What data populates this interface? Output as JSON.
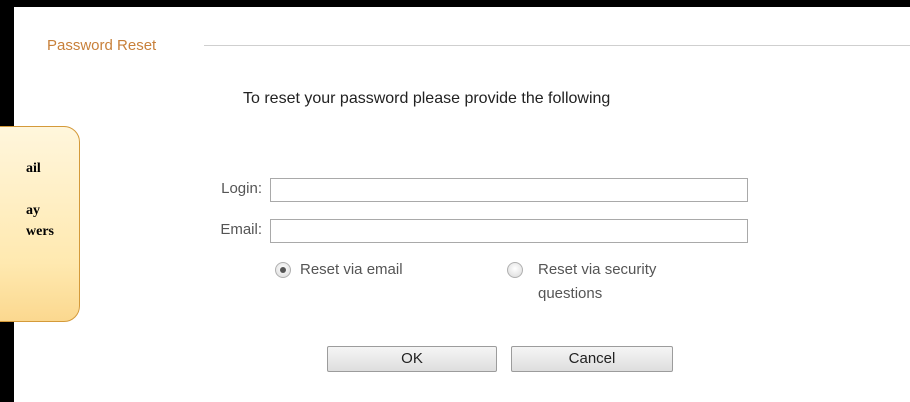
{
  "dialog": {
    "legend": "Password Reset",
    "instructions": "To reset your password please provide the following"
  },
  "form": {
    "login_label": "Login:",
    "login_value": "",
    "email_label": "Email:",
    "email_value": "",
    "reset_options": [
      {
        "label": "Reset via email",
        "selected": true
      },
      {
        "label": "Reset via security questions",
        "selected": false
      }
    ]
  },
  "buttons": {
    "ok": "OK",
    "cancel": "Cancel"
  },
  "callout": {
    "lines": [
      "ail",
      "",
      "ay",
      "wers"
    ]
  }
}
